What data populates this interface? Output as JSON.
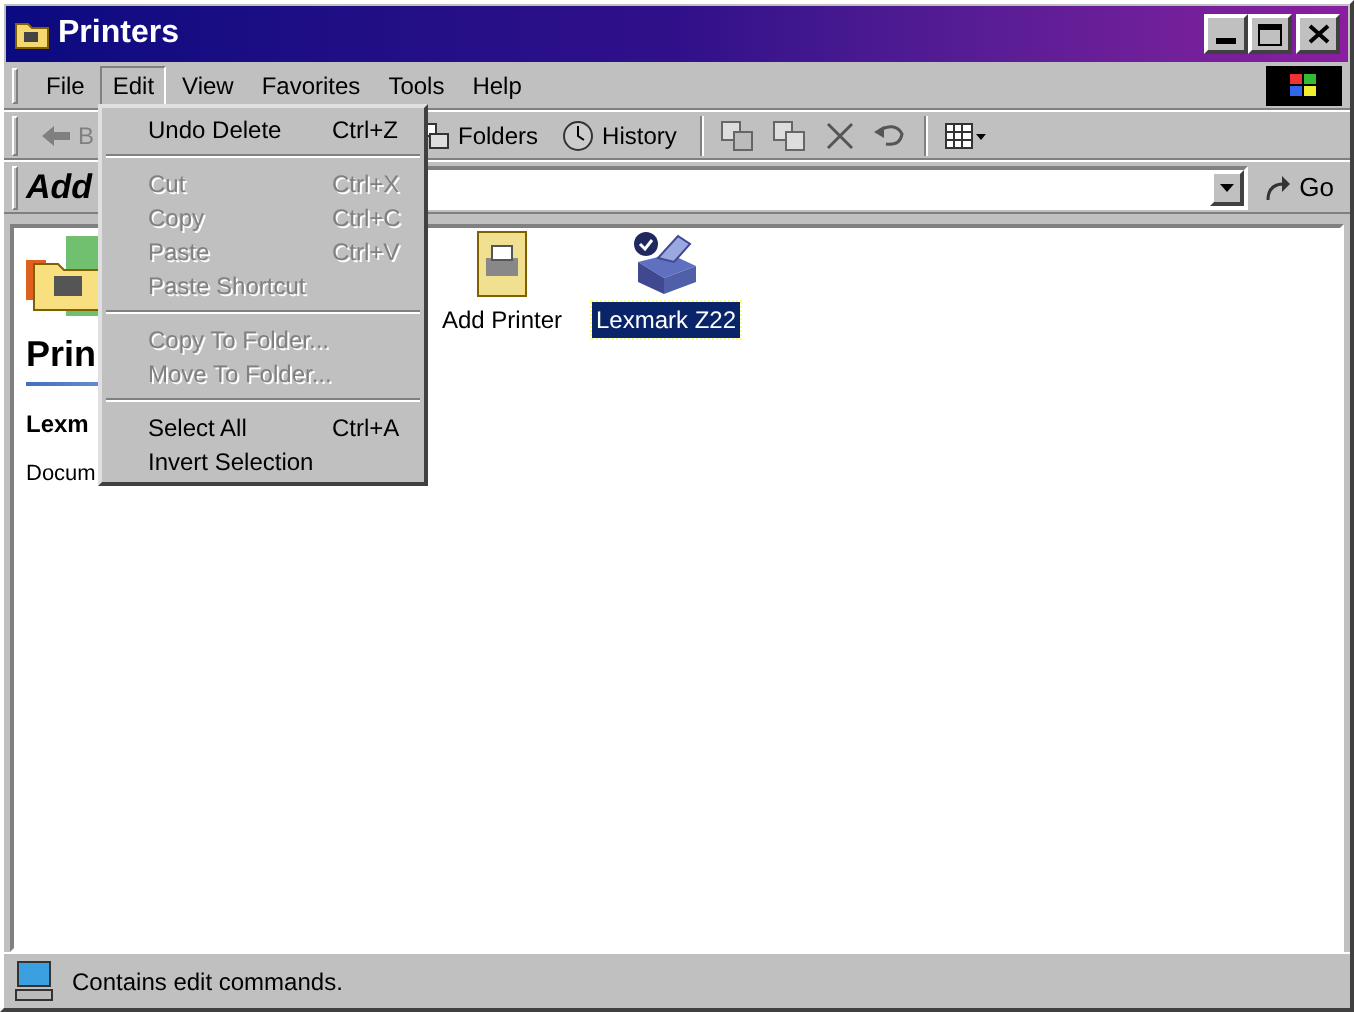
{
  "window": {
    "title": "Printers"
  },
  "menu_bar": [
    {
      "label": "File",
      "selected": false
    },
    {
      "label": "Edit",
      "selected": true
    },
    {
      "label": "View",
      "selected": false
    },
    {
      "label": "Favorites",
      "selected": false
    },
    {
      "label": "Tools",
      "selected": false
    },
    {
      "label": "Help",
      "selected": false
    }
  ],
  "edit_menu": [
    {
      "kind": "item",
      "label": "Undo Delete",
      "shortcut": "Ctrl+Z",
      "disabled": false
    },
    {
      "kind": "separator"
    },
    {
      "kind": "item",
      "label": "Cut",
      "shortcut": "Ctrl+X",
      "disabled": true
    },
    {
      "kind": "item",
      "label": "Copy",
      "shortcut": "Ctrl+C",
      "disabled": true
    },
    {
      "kind": "item",
      "label": "Paste",
      "shortcut": "Ctrl+V",
      "disabled": true
    },
    {
      "kind": "item",
      "label": "Paste Shortcut",
      "disabled": true
    },
    {
      "kind": "separator"
    },
    {
      "kind": "item",
      "label": "Copy To Folder...",
      "disabled": true
    },
    {
      "kind": "item",
      "label": "Move To Folder...",
      "disabled": true
    },
    {
      "kind": "separator"
    },
    {
      "kind": "item",
      "label": "Select All",
      "shortcut": "Ctrl+A",
      "disabled": false
    },
    {
      "kind": "item",
      "label": "Invert Selection",
      "disabled": false
    }
  ],
  "toolbar": {
    "back": "B",
    "folders": "Folders",
    "history": "History"
  },
  "address_bar": {
    "label": "Add",
    "go": "Go"
  },
  "left_panel": {
    "title": "Prin",
    "printer": "Lexm",
    "documents": "Docum"
  },
  "items": [
    {
      "label": "Add Printer",
      "kind": "add",
      "selected": false
    },
    {
      "label": "Lexmark Z22",
      "kind": "printer",
      "selected": true
    }
  ],
  "status_bar": {
    "text": "Contains edit commands."
  }
}
